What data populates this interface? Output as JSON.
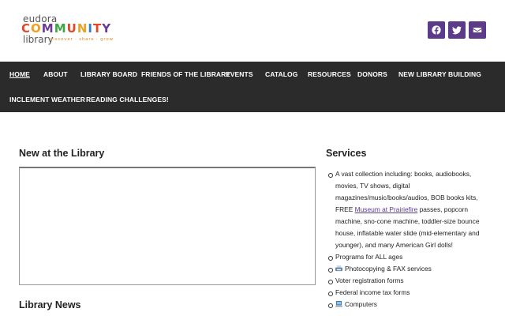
{
  "logo": {
    "top_word": "eudora",
    "big_word": "COMMUNITY",
    "bottom_word": "library",
    "tagline": "discover · share · grow",
    "letter_colors": [
      "#e0482c",
      "#f0a020",
      "#6a3b9a",
      "#3aa845",
      "#e0482c",
      "#f0a020",
      "#2f7fd0",
      "#e0482c",
      "#6a3b9a"
    ]
  },
  "socials": [
    {
      "icon": "facebook-icon",
      "label": "Facebook"
    },
    {
      "icon": "twitter-icon",
      "label": "Twitter"
    },
    {
      "icon": "email-icon",
      "label": "Email"
    }
  ],
  "nav": {
    "row1": [
      "HOME",
      "ABOUT",
      "LIBRARY BOARD",
      "FRIENDS OF THE LIBRARY",
      "EVENTS",
      "CATALOG",
      "RESOURCES",
      "DONORS",
      "NEW LIBRARY BUILDING"
    ],
    "row2": [
      "INCLEMENT WEATHER",
      "READING CHALLENGES!"
    ],
    "active": "HOME"
  },
  "main": {
    "new_heading": "New at the Library",
    "news_heading": "Library News"
  },
  "sidebar": {
    "heading": "Services",
    "item1_pre": "A vast collection including: books, audiobooks, movies, TV shows, digital magazines/music/books/audios, BOB books kits, FREE ",
    "item1_link": "Museum at Prairiefire",
    "item1_post": " passes, popcorn machine, sno-cone machine, toddler-size bounce house, inflatable water slide (mid-elementary and younger), and many American Girl dolls!",
    "items": [
      "Programs for ALL ages",
      "Photocopying & FAX services",
      "Voter registration forms",
      "Federal income tax forms",
      "Computers"
    ]
  }
}
